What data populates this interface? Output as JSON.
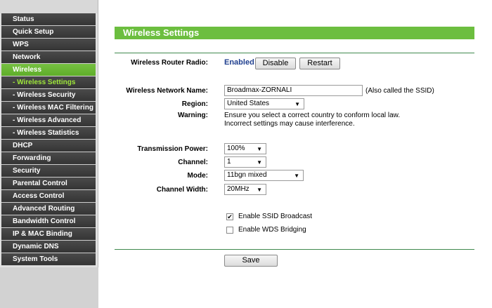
{
  "sidebar": {
    "items": [
      {
        "label": "Status"
      },
      {
        "label": "Quick Setup"
      },
      {
        "label": "WPS"
      },
      {
        "label": "Network"
      },
      {
        "label": "Wireless"
      },
      {
        "label": "- Wireless Settings"
      },
      {
        "label": "- Wireless Security"
      },
      {
        "label": "- Wireless MAC Filtering"
      },
      {
        "label": "- Wireless Advanced"
      },
      {
        "label": "- Wireless Statistics"
      },
      {
        "label": "DHCP"
      },
      {
        "label": "Forwarding"
      },
      {
        "label": "Security"
      },
      {
        "label": "Parental Control"
      },
      {
        "label": "Access Control"
      },
      {
        "label": "Advanced Routing"
      },
      {
        "label": "Bandwidth Control"
      },
      {
        "label": "IP & MAC Binding"
      },
      {
        "label": "Dynamic DNS"
      },
      {
        "label": "System Tools"
      }
    ]
  },
  "main": {
    "title": "Wireless Settings",
    "radio": {
      "label": "Wireless Router Radio:",
      "status": "Enabled",
      "disable_label": "Disable",
      "restart_label": "Restart"
    },
    "ssid": {
      "label": "Wireless Network Name:",
      "value": "Broadmax-ZORNALI",
      "note": "(Also called the SSID)"
    },
    "region": {
      "label": "Region:",
      "value": "United States"
    },
    "warning": {
      "label": "Warning:",
      "line1": "Ensure you select a correct country to conform local law.",
      "line2": "Incorrect settings may cause interference."
    },
    "tx_power": {
      "label": "Transmission Power:",
      "value": "100%"
    },
    "channel": {
      "label": "Channel:",
      "value": "1"
    },
    "mode": {
      "label": "Mode:",
      "value": "11bgn mixed"
    },
    "channel_width": {
      "label": "Channel Width:",
      "value": "20MHz"
    },
    "ssid_broadcast": {
      "label": "Enable SSID Broadcast",
      "checked": true
    },
    "wds": {
      "label": "Enable WDS Bridging",
      "checked": false
    },
    "save_label": "Save"
  },
  "colors": {
    "accent_green": "#6cbe3f",
    "nav_dark": "#3c3c3c",
    "enabled_blue": "#1f3f8f"
  }
}
